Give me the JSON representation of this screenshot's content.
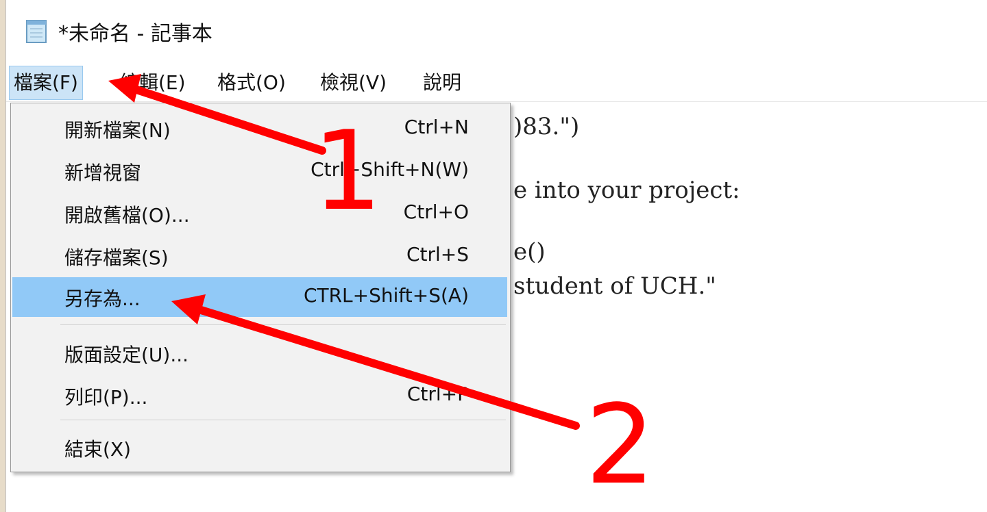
{
  "window": {
    "title": "*未命名 - 記事本",
    "icon": "notepad-icon"
  },
  "menubar": {
    "items": [
      {
        "label": "檔案(F)"
      },
      {
        "label": "編輯(E)"
      },
      {
        "label": "格式(O)"
      },
      {
        "label": "檢視(V)"
      },
      {
        "label": "說明"
      }
    ]
  },
  "file_menu": {
    "items": [
      {
        "label": "開新檔案(N)",
        "shortcut": "Ctrl+N"
      },
      {
        "label": "新增視窗",
        "shortcut": "Ctrl+Shift+N(W)"
      },
      {
        "label": "開啟舊檔(O)...",
        "shortcut": "Ctrl+O"
      },
      {
        "label": "儲存檔案(S)",
        "shortcut": "Ctrl+S"
      },
      {
        "label": "另存為...",
        "shortcut": "CTRL+Shift+S(A)",
        "highlighted": true
      },
      {
        "label": "版面設定(U)..."
      },
      {
        "label": "列印(P)...",
        "shortcut": "Ctrl+P"
      },
      {
        "label": "結束(X)"
      }
    ]
  },
  "editor": {
    "lines": [
      ")83.\")",
      "e into your project:",
      "e()",
      "student of UCH.\""
    ]
  },
  "annotations": {
    "step1": "1",
    "step2": "2",
    "color": "#ff0000"
  }
}
